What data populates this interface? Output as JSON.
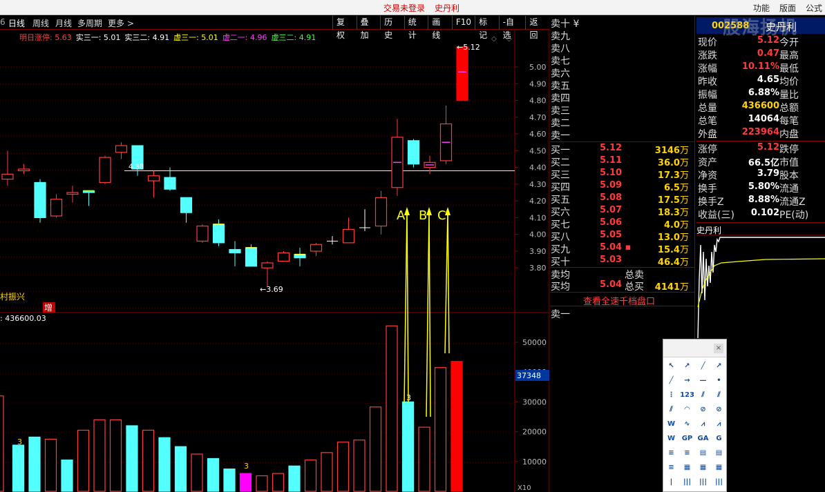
{
  "titlebar": {
    "center": [
      "交易未登录",
      "史丹利"
    ],
    "right": [
      "功能",
      "版面",
      "公式"
    ]
  },
  "watermark": "股海扬帆",
  "toolbar": {
    "left_fragment": "6",
    "tabs": [
      "日线",
      "周线",
      "月线",
      "多周期",
      "更多 >"
    ],
    "buttons": [
      "复权",
      "叠加",
      "历史",
      "统计",
      "画线",
      "F10",
      "标记",
      "-自选",
      "返回"
    ]
  },
  "indicator": {
    "items": [
      {
        "label": "明日涨停: 5.63",
        "color": "#ff4040"
      },
      {
        "label": "实三一: 5.01",
        "color": "#ffffff"
      },
      {
        "label": "实三二: 4.91",
        "color": "#ffffff"
      },
      {
        "label": "虚三一: 5.01",
        "color": "#ffff00"
      },
      {
        "label": "虚二一: 4.96",
        "color": "#ff40ff"
      },
      {
        "label": "虚三二: 4.91",
        "color": "#40ff40"
      }
    ]
  },
  "chart_data": {
    "type": "candlestick",
    "price_axis": {
      "ticks": [
        5.0,
        4.9,
        4.8,
        4.7,
        4.6,
        4.5,
        4.4,
        4.3,
        4.2,
        4.1,
        4.0,
        3.9,
        3.8
      ],
      "range": [
        3.7,
        5.12
      ]
    },
    "volume_axis": {
      "ticks": [
        50000,
        40000,
        30000,
        20000,
        10000
      ],
      "highlight": "37348",
      "unit_label": "X10"
    },
    "reference_line": 4.38,
    "labels": {
      "ref": "4.38",
      "low": "←3.69",
      "high": "←5.12",
      "abc": [
        "A",
        "B",
        "C"
      ],
      "three": "3",
      "vol_label": ": 436600.03",
      "name_left": "村振兴",
      "zeng": "增"
    },
    "candles": [
      {
        "o": 4.33,
        "h": 4.5,
        "l": 4.29,
        "c": 4.36,
        "dir": "up"
      },
      {
        "o": 4.38,
        "h": 4.42,
        "l": 4.36,
        "c": 4.39,
        "dir": "up"
      },
      {
        "o": 4.31,
        "h": 4.33,
        "l": 4.07,
        "c": 4.1,
        "dir": "down"
      },
      {
        "o": 4.11,
        "h": 4.24,
        "l": 4.1,
        "c": 4.21,
        "dir": "up"
      },
      {
        "o": 4.24,
        "h": 4.29,
        "l": 4.19,
        "c": 4.25,
        "dir": "up"
      },
      {
        "o": 4.26,
        "h": 4.26,
        "l": 4.17,
        "c": 4.25,
        "dir": "up_green"
      },
      {
        "o": 4.31,
        "h": 4.47,
        "l": 4.3,
        "c": 4.46,
        "dir": "up"
      },
      {
        "o": 4.49,
        "h": 4.55,
        "l": 4.45,
        "c": 4.53,
        "dir": "up"
      },
      {
        "o": 4.53,
        "h": 4.53,
        "l": 4.35,
        "c": 4.39,
        "dir": "down"
      },
      {
        "o": 4.32,
        "h": 4.38,
        "l": 4.22,
        "c": 4.35,
        "dir": "up"
      },
      {
        "o": 4.34,
        "h": 4.4,
        "l": 4.26,
        "c": 4.27,
        "dir": "down"
      },
      {
        "o": 4.22,
        "h": 4.22,
        "l": 4.07,
        "c": 4.13,
        "dir": "down"
      },
      {
        "o": 3.96,
        "h": 4.06,
        "l": 3.95,
        "c": 4.05,
        "dir": "up"
      },
      {
        "o": 4.06,
        "h": 4.09,
        "l": 3.93,
        "c": 3.95,
        "dir": "down_yellow"
      },
      {
        "o": 3.91,
        "h": 3.96,
        "l": 3.81,
        "c": 3.89,
        "dir": "down"
      },
      {
        "o": 3.92,
        "h": 3.94,
        "l": 3.81,
        "c": 3.81,
        "dir": "down_yellow"
      },
      {
        "o": 3.8,
        "h": 3.84,
        "l": 3.69,
        "c": 3.83,
        "dir": "up"
      },
      {
        "o": 3.84,
        "h": 3.9,
        "l": 3.84,
        "c": 3.89,
        "dir": "up"
      },
      {
        "o": 3.88,
        "h": 3.92,
        "l": 3.81,
        "c": 3.86,
        "dir": "down_yellow"
      },
      {
        "o": 3.9,
        "h": 3.95,
        "l": 3.87,
        "c": 3.94,
        "dir": "up"
      },
      {
        "o": 3.96,
        "h": 3.99,
        "l": 3.94,
        "c": 3.96,
        "dir": "flat"
      },
      {
        "o": 3.95,
        "h": 4.1,
        "l": 3.95,
        "c": 4.03,
        "dir": "up"
      },
      {
        "o": 4.04,
        "h": 4.15,
        "l": 4.02,
        "c": 4.04,
        "dir": "flat"
      },
      {
        "o": 4.05,
        "h": 4.26,
        "l": 4.0,
        "c": 4.22,
        "dir": "up"
      },
      {
        "o": 4.28,
        "h": 4.69,
        "l": 4.23,
        "c": 4.58,
        "dir": "up"
      },
      {
        "o": 4.56,
        "h": 4.57,
        "l": 4.4,
        "c": 4.42,
        "dir": "down"
      },
      {
        "o": 4.4,
        "h": 4.47,
        "l": 4.36,
        "c": 4.43,
        "dir": "up"
      },
      {
        "o": 4.44,
        "h": 4.77,
        "l": 4.42,
        "c": 4.66,
        "dir": "up"
      },
      {
        "o": 4.8,
        "h": 5.12,
        "l": 4.8,
        "c": 5.12,
        "dir": "limit_up"
      }
    ],
    "volumes": [
      32000,
      15500,
      18200,
      17500,
      10500,
      20500,
      24000,
      24000,
      22000,
      20500,
      18000,
      15000,
      12500,
      11000,
      7500,
      6000,
      5200,
      6000,
      8500,
      10500,
      13000,
      16500,
      17200,
      28300,
      55500,
      30000,
      21500,
      41500,
      43600
    ],
    "volume_colors": [
      "up",
      "down",
      "down",
      "up",
      "down",
      "up",
      "up",
      "up",
      "down",
      "up",
      "down",
      "down",
      "up",
      "down",
      "down",
      "magenta",
      "up",
      "up",
      "down",
      "up",
      "up",
      "up",
      "up",
      "up",
      "up",
      "down",
      "up",
      "up",
      "limit_up"
    ]
  },
  "orderbook": {
    "sells_top": [
      "卖十 ¥",
      "卖九",
      "卖八",
      "卖七",
      "卖六",
      "卖五",
      "卖四",
      "卖三",
      "卖二",
      "卖一"
    ],
    "buys": [
      {
        "label": "买一",
        "price": "5.12",
        "vol": "3146",
        "unit": "万"
      },
      {
        "label": "买二",
        "price": "5.11",
        "vol": "36.0",
        "unit": "万"
      },
      {
        "label": "买三",
        "price": "5.10",
        "vol": "17.3",
        "unit": "万"
      },
      {
        "label": "买四",
        "price": "5.09",
        "vol": "6.5",
        "unit": "万"
      },
      {
        "label": "买五",
        "price": "5.08",
        "vol": "17.5",
        "unit": "万"
      },
      {
        "label": "买六",
        "price": "5.07",
        "vol": "18.3",
        "unit": "万"
      },
      {
        "label": "买七",
        "price": "5.06",
        "vol": "4.0",
        "unit": "万"
      },
      {
        "label": "买八",
        "price": "5.05",
        "vol": "13.0",
        "unit": "万"
      },
      {
        "label": "买九",
        "price": "5.04",
        "vol": "15.4",
        "unit": "万",
        "mark": "▪"
      },
      {
        "label": "买十",
        "price": "5.03",
        "vol": "46.4",
        "unit": "万"
      }
    ],
    "sell_avg": {
      "label": "卖均",
      "mid": "总卖"
    },
    "buy_avg": {
      "label": "买均",
      "price": "5.04",
      "mid": "总买",
      "vol": "4141",
      "unit": "万"
    },
    "full_depth_link": "查看全速千档盘口",
    "bottom_sell": "卖一"
  },
  "quote": {
    "code": "002588",
    "name": "史丹利",
    "rows1": [
      {
        "l": "现价",
        "v": "5.12",
        "c": "#ff3b3b",
        "l2": "今开"
      },
      {
        "l": "涨跌",
        "v": "0.47",
        "c": "#ff3b3b",
        "l2": "最高"
      },
      {
        "l": "涨幅",
        "v": "10.11%",
        "c": "#ff3b3b",
        "l2": "最低"
      },
      {
        "l": "昨收",
        "v": "4.65",
        "c": "#ffffff",
        "l2": "均价"
      },
      {
        "l": "振幅",
        "v": "6.88%",
        "c": "#ffffff",
        "l2": "量比"
      },
      {
        "l": "总量",
        "v": "436600",
        "c": "#ffd400",
        "l2": "总额"
      },
      {
        "l": "总笔",
        "v": "14064",
        "c": "#ffffff",
        "l2": "每笔"
      },
      {
        "l": "外盘",
        "v": "223964",
        "c": "#ff3b3b",
        "l2": "内盘"
      }
    ],
    "rows2": [
      {
        "l": "涨停",
        "v": "5.12",
        "c": "#ff3b3b",
        "l2": "跌停"
      },
      {
        "l": "资产",
        "v": "66.5亿",
        "c": "#ffffff",
        "l2": "市值"
      },
      {
        "l": "净资",
        "v": "3.79",
        "c": "#ffffff",
        "l2": "股本"
      },
      {
        "l": "换手",
        "v": "5.80%",
        "c": "#ffffff",
        "l2": "流通"
      },
      {
        "l": "换手Z",
        "v": "8.88%",
        "c": "#ffffff",
        "l2": "流通Z"
      },
      {
        "l": "收益(三)",
        "v": "0.102",
        "c": "#ffffff",
        "l2": "PE(动)"
      }
    ]
  },
  "mini_chart": {
    "title": "史丹利"
  },
  "drawtools": {
    "tools": [
      "↖",
      "↗",
      "╱",
      "↗",
      "╱",
      "→",
      "—",
      "•",
      "⋮",
      "123",
      "⫽",
      "⫽",
      "⫽",
      "◠",
      "⊘",
      "⊘",
      "W",
      "∿",
      "⩘",
      "⩘",
      "W",
      "GP",
      "GA",
      "G",
      "≡",
      "≡",
      "▤",
      "▤",
      "≡",
      "▦",
      "▦",
      "▦",
      "|",
      "|||",
      "|||",
      "|||"
    ]
  }
}
